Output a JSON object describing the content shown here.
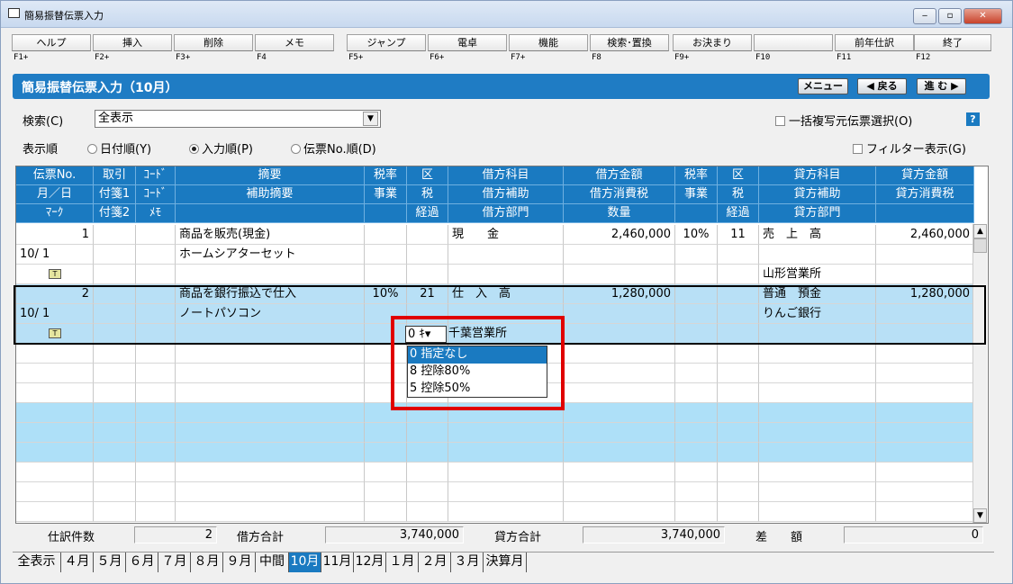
{
  "window": {
    "title": "簡易振替伝票入力",
    "min": "‒",
    "max": "▫",
    "close": "✕"
  },
  "fkeys": [
    {
      "label": "ヘルプ",
      "key": "F1+"
    },
    {
      "label": "挿入",
      "key": "F2+"
    },
    {
      "label": "削除",
      "key": "F3+"
    },
    {
      "label": "メモ",
      "key": "F4"
    },
    {
      "label": "ジャンプ",
      "key": "F5+"
    },
    {
      "label": "電卓",
      "key": "F6+"
    },
    {
      "label": "機能",
      "key": "F7+"
    },
    {
      "label": "検索･置換",
      "key": "F8"
    },
    {
      "label": "お決まり",
      "key": "F9+"
    },
    {
      "label": "",
      "key": "F10"
    },
    {
      "label": "前年仕訳",
      "key": "F11"
    },
    {
      "label": "終了",
      "key": "F12"
    }
  ],
  "banner": {
    "title": "簡易振替伝票入力（10月）",
    "menu": "メニュー",
    "back": "◀ 戻る",
    "next": "進 む ▶"
  },
  "search": {
    "label": "検索(C)",
    "value": "全表示",
    "copy_label": "一括複写元伝票選択(O)",
    "help": "?"
  },
  "order": {
    "label": "表示順",
    "date": "日付順(Y)",
    "input": "入力順(P)",
    "voucher": "伝票No.順(D)",
    "filter": "フィルター表示(G)"
  },
  "headers": {
    "row1": [
      "伝票No.",
      "取引",
      "ｺｰﾄﾞ",
      "摘要",
      "税率",
      "区",
      "借方科目",
      "借方金額",
      "税率",
      "区",
      "貸方科目",
      "貸方金額"
    ],
    "row2": [
      "月／日",
      "付箋1",
      "ｺｰﾄﾞ",
      "補助摘要",
      "事業",
      "税",
      "借方補助",
      "借方消費税",
      "事業",
      "税",
      "貸方補助",
      "貸方消費税"
    ],
    "row3": [
      "ﾏｰｸ",
      "付箋2",
      "ﾒﾓ",
      "",
      "",
      "経過",
      "借方部門",
      "数量",
      "",
      "経過",
      "貸方部門",
      ""
    ]
  },
  "entries": [
    {
      "no": "1",
      "date": "10/ 1",
      "mark": "Ｔ",
      "tekiyo": "商品を販売(現金)",
      "hojo": "ホームシアターセット",
      "rate1": "",
      "ku1": "",
      "debit": "現　　金",
      "debit_amt": "2,460,000",
      "rate2": "10%",
      "ku2": "11",
      "credit": "売　上　高",
      "credit_sub": "",
      "credit_dept": "山形営業所",
      "credit_amt": "2,460,000"
    },
    {
      "no": "2",
      "date": "10/ 1",
      "mark": "Ｔ",
      "tekiyo": "商品を銀行振込で仕入",
      "hojo": "ノートパソコン",
      "rate1": "10%",
      "ku1": "21",
      "debit": "仕　入　高",
      "debit_amt": "1,280,000",
      "rate2": "",
      "ku2": "",
      "credit": "普通　預金",
      "credit_sub": "りんご銀行",
      "credit_dept": "",
      "credit_amt": "1,280,000",
      "debit_dept": "千葉営業所"
    }
  ],
  "popup": {
    "combo_value": "0 ｷ▾",
    "options": [
      "0 指定なし",
      "8 控除80%",
      "5 控除50%"
    ]
  },
  "summary": {
    "count_label": "仕訳件数",
    "count": "2",
    "debit_label": "借方合計",
    "debit_total": "3,740,000",
    "credit_label": "貸方合計",
    "credit_total": "3,740,000",
    "diff_label": "差　　額",
    "diff": "0"
  },
  "tabs": [
    "全表示",
    "４月",
    "５月",
    "６月",
    "７月",
    "８月",
    "９月",
    "中間",
    "10月",
    "11月",
    "12月",
    "１月",
    "２月",
    "３月",
    "決算月"
  ],
  "colors": {
    "accent": "#1a7ac1",
    "selected_row": "#b8e0f6",
    "highlight": "#e00000"
  }
}
